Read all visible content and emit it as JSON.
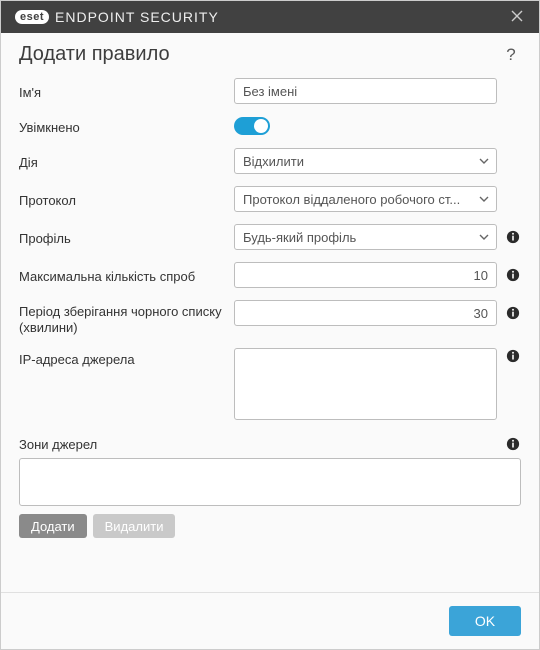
{
  "titlebar": {
    "brand_badge": "eset",
    "product": "ENDPOINT SECURITY"
  },
  "header": {
    "title": "Додати правило"
  },
  "form": {
    "name": {
      "label": "Ім'я",
      "value": "Без імені"
    },
    "enabled": {
      "label": "Увімкнено",
      "value": true
    },
    "action": {
      "label": "Дія",
      "value": "Відхилити"
    },
    "protocol": {
      "label": "Протокол",
      "value": "Протокол віддаленого робочого ст..."
    },
    "profile": {
      "label": "Профіль",
      "value": "Будь-який профіль"
    },
    "max_attempts": {
      "label": "Максимальна кількість спроб",
      "value": "10"
    },
    "blacklist_period": {
      "label": "Період зберігання чорного списку (хвилини)",
      "value": "30"
    },
    "source_ip": {
      "label": "IP-адреса джерела",
      "value": ""
    },
    "zones": {
      "label": "Зони джерел",
      "add_label": "Додати",
      "delete_label": "Видалити"
    }
  },
  "footer": {
    "ok_label": "OK"
  }
}
